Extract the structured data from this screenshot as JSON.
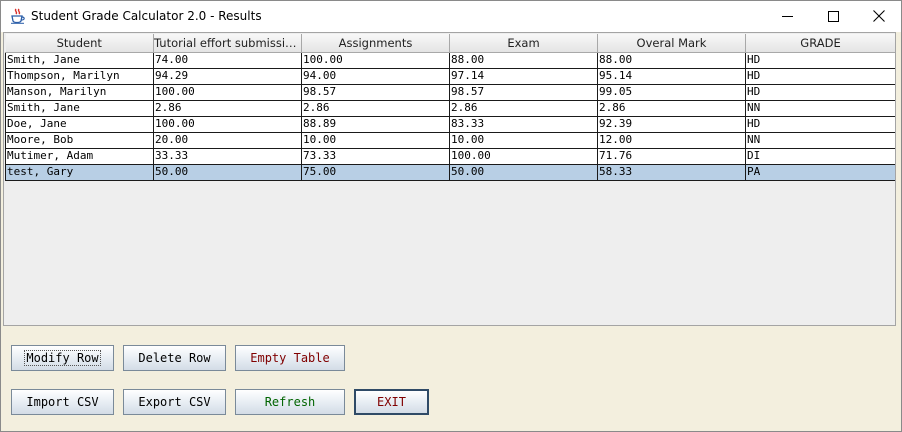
{
  "window": {
    "title": "Student Grade Calculator 2.0 - Results"
  },
  "table": {
    "columns": [
      "Student",
      "Tutorial effort submissio...",
      "Assignments",
      "Exam",
      "Overal Mark",
      "GRADE"
    ],
    "rows": [
      [
        "Smith, Jane",
        "74.00",
        "100.00",
        "88.00",
        "88.00",
        "HD"
      ],
      [
        "Thompson, Marilyn",
        "94.29",
        "94.00",
        "97.14",
        "95.14",
        "HD"
      ],
      [
        "Manson, Marilyn",
        "100.00",
        "98.57",
        "98.57",
        "99.05",
        "HD"
      ],
      [
        "Smith, Jane",
        "2.86",
        "2.86",
        "2.86",
        "2.86",
        "NN"
      ],
      [
        "Doe, Jane",
        "100.00",
        "88.89",
        "83.33",
        "92.39",
        "HD"
      ],
      [
        "Moore, Bob",
        "20.00",
        "10.00",
        "10.00",
        "12.00",
        "NN"
      ],
      [
        "Mutimer, Adam",
        "33.33",
        "73.33",
        "100.00",
        "71.76",
        "DI"
      ],
      [
        "test, Gary",
        "50.00",
        "75.00",
        "50.00",
        "58.33",
        "PA"
      ]
    ],
    "selected_row": 7
  },
  "buttons": {
    "modify_row": "Modify Row",
    "delete_row": "Delete Row",
    "empty_table": "Empty Table",
    "import_csv": "Import CSV",
    "export_csv": "Export CSV",
    "refresh": "Refresh",
    "exit": "EXIT"
  },
  "colors": {
    "selected_row": "#b8cfe5",
    "panel_background": "#f3efde",
    "empty_table_text": "#800000",
    "refresh_text": "#006400",
    "exit_text": "#800000"
  },
  "icons": {
    "app": "java-cup-icon",
    "minimize": "minimize-icon",
    "maximize": "maximize-icon",
    "close": "close-icon"
  }
}
